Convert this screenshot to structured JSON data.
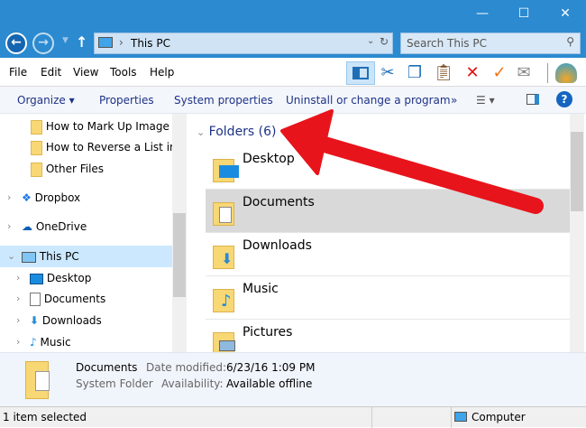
{
  "window": {
    "minimize": "—",
    "maximize": "☐",
    "close": "✕"
  },
  "address": {
    "path": "This PC",
    "search_placeholder": "Search This PC"
  },
  "menu": [
    "File",
    "Edit",
    "View",
    "Tools",
    "Help"
  ],
  "commands": {
    "organize": "Organize ▾",
    "properties": "Properties",
    "system_properties": "System properties",
    "uninstall": "Uninstall or change a program",
    "more": "»"
  },
  "nav": {
    "items": [
      {
        "label": "How to Mark Up Image At",
        "icon": "folder-icon"
      },
      {
        "label": "How to Reverse a List in M",
        "icon": "folder-icon"
      },
      {
        "label": "Other Files",
        "icon": "folder-icon"
      },
      {
        "label": "Dropbox",
        "icon": "dropbox-icon"
      },
      {
        "label": "OneDrive",
        "icon": "onedrive-icon"
      },
      {
        "label": "This PC",
        "icon": "computer-icon"
      },
      {
        "label": "Desktop",
        "icon": "desktop-icon"
      },
      {
        "label": "Documents",
        "icon": "documents-icon"
      },
      {
        "label": "Downloads",
        "icon": "downloads-icon"
      },
      {
        "label": "Music",
        "icon": "music-icon"
      }
    ]
  },
  "main": {
    "group": "Folders (6)",
    "folders": [
      "Desktop",
      "Documents",
      "Downloads",
      "Music",
      "Pictures"
    ],
    "selected": "Documents"
  },
  "details": {
    "name": "Documents",
    "type": "System Folder",
    "date_label": "Date modified:",
    "date": "6/23/16 1:09 PM",
    "avail_label": "Availability:",
    "avail": "Available offline"
  },
  "status": {
    "left": "1 item selected",
    "right": "Computer"
  },
  "colors": {
    "accent": "#2b8ad0",
    "arrow": "#e8141b"
  }
}
